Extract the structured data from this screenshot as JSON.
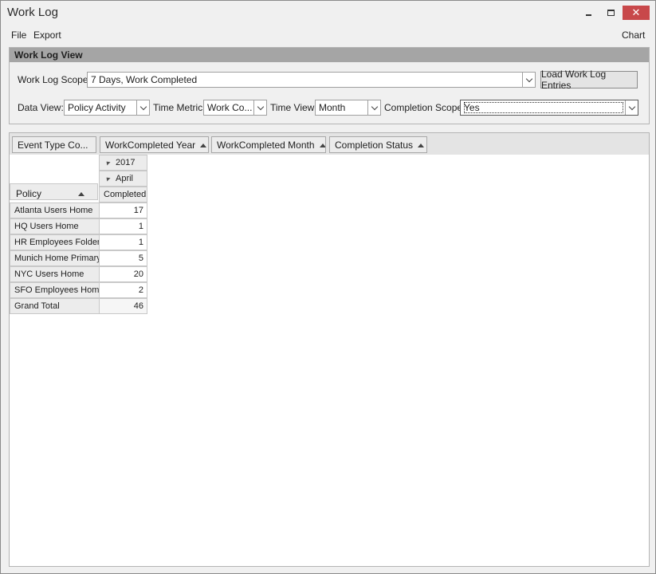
{
  "window": {
    "title": "Work Log",
    "minimize_icon": "minimize-icon",
    "maximize_icon": "maximize-icon",
    "close_glyph": "✕"
  },
  "menu": {
    "file": "File",
    "export": "Export",
    "chart": "Chart"
  },
  "view_group": {
    "title": "Work Log View",
    "scope_label": "Work Log Scope:",
    "scope_value": "7 Days, Work Completed",
    "load_button": "Load Work Log Entries",
    "data_view_label": "Data View:",
    "data_view_value": "Policy Activity",
    "time_metric_label": "Time Metric:",
    "time_metric_value": "Work Co...",
    "time_view_label": "Time View:",
    "time_view_value": "Month",
    "completion_scope_label": "Completion Scope:",
    "completion_scope_value": "Yes"
  },
  "pivot": {
    "fields": [
      "Event Type Co...",
      "WorkCompleted Year",
      "WorkCompleted Month",
      "Completion Status"
    ],
    "year": "2017",
    "month": "April",
    "status": "Completed",
    "row_field": "Policy",
    "rows": [
      {
        "policy": "Atlanta Users Home",
        "value": "17"
      },
      {
        "policy": "HQ Users Home",
        "value": "1"
      },
      {
        "policy": "HR Employees Folder",
        "value": "1"
      },
      {
        "policy": "Munich Home Primary",
        "value": "5"
      },
      {
        "policy": "NYC Users Home",
        "value": "20"
      },
      {
        "policy": "SFO Employees Home",
        "value": "2"
      }
    ],
    "grand_total_label": "Grand Total",
    "grand_total_value": "46"
  }
}
